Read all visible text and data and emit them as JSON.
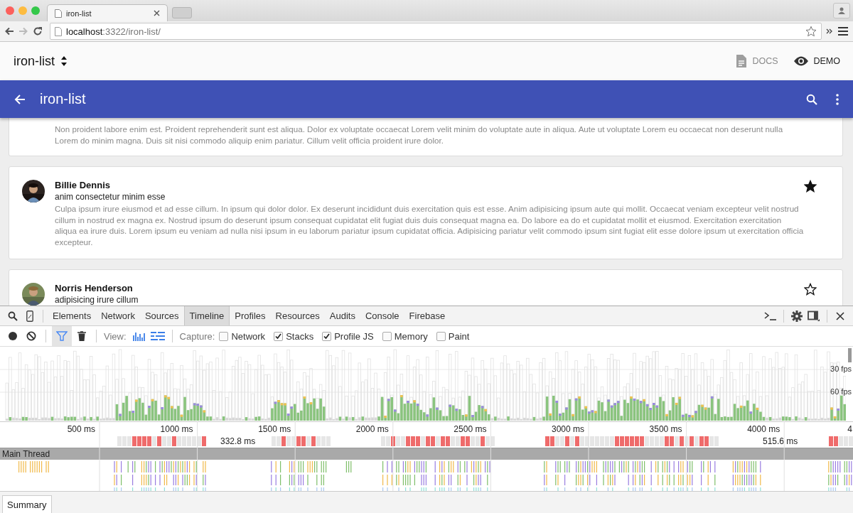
{
  "browser": {
    "tab_title": "iron-list",
    "address": "**localhost**:3322/iron-list/"
  },
  "app_bar": {
    "title": "iron-list",
    "links": [
      {
        "label": "DOCS",
        "selected": false
      },
      {
        "label": "DEMO",
        "selected": true
      }
    ]
  },
  "toolbar": {
    "title": "iron-list"
  },
  "cards": [
    {
      "body": "Non proident labore enim est. Proident reprehenderit sunt est aliqua. Dolor ex voluptate occaecat Lorem velit minim do voluptate aute in aliqua. Aute ut voluptate Lorem eu occaecat non deserunt nulla Lorem do minim magna. Duis sit nisi commodo aliquip enim pariatur. Cillum velit officia proident irure dolor."
    },
    {
      "name": "Billie Dennis",
      "subtitle": "anim consectetur minim esse",
      "body": "Culpa ipsum irure eiusmod et ad esse cillum. In ipsum qui dolor dolor. Ex deserunt incididunt duis exercitation quis est esse. Anim adipisicing ipsum aute qui mollit. Occaecat veniam excepteur velit nostrud cillum in nostrud ex magna ex. Nostrud ipsum do deserunt ipsum consequat cupidatat elit fugiat duis duis consequat magna ea. Do labore ea do et cupidatat mollit et eiusmod. Exercitation exercitation aliqua ea irure duis. Lorem ipsum eu veniam ad nulla nisi ipsum in eu laborum pariatur ipsum cupidatat officia. Adipisicing pariatur velit commodo ipsum sint fugiat elit esse dolore ipsum ut exercitation officia excepteur.",
      "starred": true
    },
    {
      "name": "Norris Henderson",
      "subtitle": "adipisicing irure cillum",
      "starred": false
    }
  ],
  "devtools": {
    "tabs": [
      {
        "label": "Elements",
        "selected": false
      },
      {
        "label": "Network",
        "selected": false
      },
      {
        "label": "Sources",
        "selected": false
      },
      {
        "label": "Timeline",
        "selected": true
      },
      {
        "label": "Profiles",
        "selected": false
      },
      {
        "label": "Resources",
        "selected": false
      },
      {
        "label": "Audits",
        "selected": false
      },
      {
        "label": "Console",
        "selected": false
      },
      {
        "label": "Firebase",
        "selected": false
      }
    ],
    "filter_active": true,
    "view_label": "View:",
    "capture_label": "Capture:",
    "capture": [
      {
        "label": "Network",
        "checked": false
      },
      {
        "label": "Stacks",
        "checked": true
      },
      {
        "label": "Profile JS",
        "checked": true
      },
      {
        "label": "Memory",
        "checked": false
      },
      {
        "label": "Paint",
        "checked": false
      }
    ],
    "fps_labels": [
      "30 fps",
      "60 fps"
    ],
    "ticks": [
      "500 ms",
      "1000 ms",
      "1500 ms",
      "2000 ms",
      "2500 ms",
      "3000 ms",
      "3500 ms",
      "4000 ms",
      "4"
    ],
    "frame_durations": [
      "332.8 ms",
      "515.6 ms"
    ],
    "track_title": "Main Thread",
    "bottom_tab": "Summary"
  }
}
